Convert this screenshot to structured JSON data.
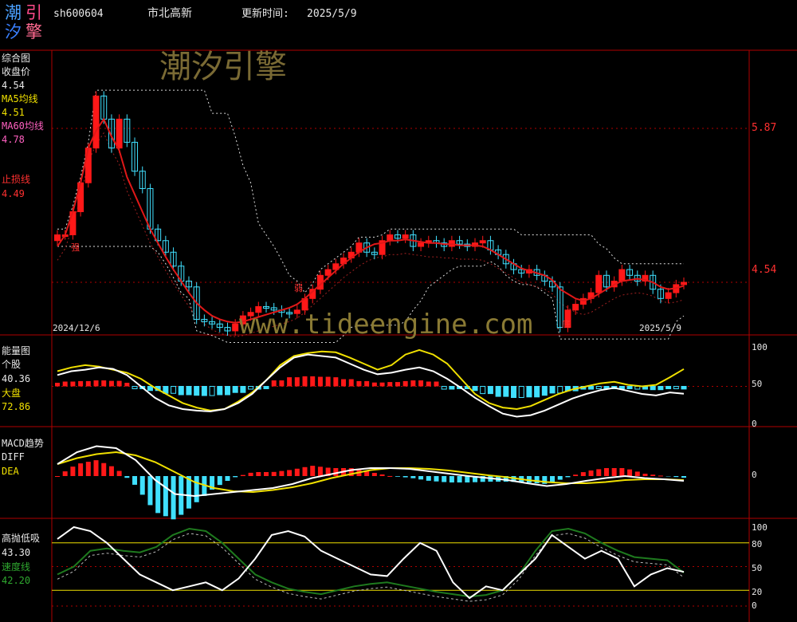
{
  "logo": {
    "c1": "潮",
    "c2": "引",
    "c3": "汐",
    "c4": "擎"
  },
  "header": {
    "code": "sh600604",
    "name": "市北高新",
    "update_label": "更新时间:",
    "update_date": "2025/5/9"
  },
  "watermark": {
    "cn": "潮汐引擎",
    "url": "www.tideengine.com"
  },
  "panel1": {
    "title": "综合图",
    "close_label": "收盘价",
    "close_value": "4.54",
    "ma5_label": "MA5均线",
    "ma5_value": "4.51",
    "ma60_label": "MA60均线",
    "ma60_value": "4.78",
    "stop_label": "止损线",
    "stop_value": "4.49",
    "right_ticks": [
      "5.87",
      "4.54"
    ],
    "date_start": "2024/12/6",
    "date_end": "2025/5/9",
    "marker_strong": "强",
    "marker_weak": "弱",
    "marker_bottom": "底"
  },
  "panel2": {
    "title": "能量图",
    "stock_label": "个股",
    "stock_value": "40.36",
    "market_label": "大盘",
    "market_value": "72.86",
    "ticks": [
      "100",
      "50",
      "0"
    ]
  },
  "panel3": {
    "title": "MACD趋势",
    "diff_label": "DIFF",
    "dea_label": "DEA",
    "ticks": [
      "0"
    ]
  },
  "panel4": {
    "title": "高抛低吸",
    "value1": "43.30",
    "speed_label": "速度线",
    "speed_value": "42.20",
    "ticks": [
      "100",
      "80",
      "50",
      "20",
      "0"
    ]
  },
  "colors": {
    "up": "#ff1818",
    "down": "#40e0ff",
    "ma": "#e01818",
    "grid": "#b00000",
    "yellow": "#f0e000",
    "green": "#1e7a1e"
  },
  "chart_data": [
    {
      "type": "candlestick",
      "title": "综合图",
      "x_start": "2024/12/6",
      "x_end": "2025/5/9",
      "ylim": [
        3.9,
        6.5
      ],
      "yticks": [
        5.87,
        4.54
      ],
      "close": [
        4.95,
        4.95,
        5.15,
        5.4,
        5.7,
        6.15,
        5.95,
        5.7,
        5.95,
        5.75,
        5.5,
        5.35,
        5.0,
        4.9,
        4.8,
        4.68,
        4.55,
        4.5,
        4.22,
        4.2,
        4.18,
        4.15,
        4.12,
        4.18,
        4.25,
        4.28,
        4.33,
        4.32,
        4.3,
        4.28,
        4.27,
        4.3,
        4.4,
        4.48,
        4.6,
        4.65,
        4.7,
        4.75,
        4.8,
        4.88,
        4.8,
        4.78,
        4.9,
        4.95,
        4.92,
        4.95,
        4.85,
        4.88,
        4.9,
        4.88,
        4.85,
        4.9,
        4.87,
        4.85,
        4.88,
        4.9,
        4.82,
        4.78,
        4.7,
        4.65,
        4.62,
        4.65,
        4.6,
        4.55,
        4.5,
        4.15,
        4.3,
        4.35,
        4.4,
        4.45,
        4.6,
        4.5,
        4.55,
        4.65,
        4.6,
        4.55,
        4.6,
        4.48,
        4.4,
        4.45,
        4.52,
        4.54
      ],
      "ma5": [
        4.85,
        4.95,
        5.15,
        5.4,
        5.7,
        5.85,
        5.95,
        5.8,
        5.68,
        5.45,
        5.3,
        5.15,
        5.0,
        4.88,
        4.76,
        4.65,
        4.55,
        4.45,
        4.36,
        4.3,
        4.25,
        4.22,
        4.2,
        4.19,
        4.2,
        4.22,
        4.24,
        4.26,
        4.28,
        4.3,
        4.32,
        4.35,
        4.4,
        4.46,
        4.52,
        4.58,
        4.64,
        4.7,
        4.75,
        4.8,
        4.84,
        4.87,
        4.88,
        4.9,
        4.9,
        4.91,
        4.9,
        4.89,
        4.88,
        4.88,
        4.87,
        4.87,
        4.86,
        4.86,
        4.86,
        4.85,
        4.82,
        4.78,
        4.74,
        4.7,
        4.66,
        4.64,
        4.62,
        4.6,
        4.56,
        4.48,
        4.44,
        4.4,
        4.38,
        4.4,
        4.44,
        4.48,
        4.52,
        4.55,
        4.56,
        4.57,
        4.56,
        4.54,
        4.5,
        4.48,
        4.49,
        4.51
      ],
      "ma60": 4.78,
      "stop_line": 4.49
    },
    {
      "type": "line",
      "title": "能量图",
      "ylim": [
        0,
        100
      ],
      "yticks": [
        100,
        50,
        0
      ],
      "series": [
        {
          "name": "个股",
          "values": [
            65,
            70,
            72,
            75,
            73,
            65,
            50,
            35,
            25,
            20,
            18,
            17,
            20,
            28,
            40,
            58,
            75,
            88,
            92,
            90,
            88,
            80,
            72,
            66,
            68,
            72,
            75,
            70,
            60,
            48,
            35,
            24,
            14,
            10,
            12,
            18,
            26,
            34,
            40,
            45,
            48,
            44,
            40,
            38,
            42,
            40.36
          ]
        },
        {
          "name": "大盘",
          "values": [
            70,
            75,
            78,
            76,
            72,
            68,
            60,
            48,
            38,
            28,
            22,
            18,
            20,
            30,
            42,
            58,
            78,
            90,
            94,
            96,
            95,
            88,
            80,
            72,
            78,
            92,
            98,
            92,
            80,
            60,
            40,
            28,
            22,
            20,
            24,
            32,
            40,
            46,
            50,
            54,
            56,
            52,
            50,
            52,
            62,
            72.86
          ]
        }
      ]
    },
    {
      "type": "line",
      "title": "MACD趋势",
      "ylim": [
        -1,
        1
      ],
      "yticks": [
        0
      ],
      "series": [
        {
          "name": "DIFF",
          "values": [
            0.3,
            0.6,
            0.75,
            0.7,
            0.4,
            -0.1,
            -0.45,
            -0.5,
            -0.45,
            -0.4,
            -0.35,
            -0.3,
            -0.2,
            -0.05,
            0.05,
            0.15,
            0.2,
            0.2,
            0.18,
            0.12,
            0.06,
            0.0,
            -0.05,
            -0.1,
            -0.18,
            -0.25,
            -0.2,
            -0.12,
            -0.05,
            0.0,
            -0.05,
            -0.08,
            -0.12
          ]
        },
        {
          "name": "DEA",
          "values": [
            0.3,
            0.45,
            0.55,
            0.6,
            0.52,
            0.35,
            0.1,
            -0.15,
            -0.3,
            -0.38,
            -0.4,
            -0.35,
            -0.28,
            -0.18,
            -0.05,
            0.05,
            0.15,
            0.2,
            0.2,
            0.18,
            0.14,
            0.08,
            0.02,
            -0.03,
            -0.1,
            -0.15,
            -0.18,
            -0.18,
            -0.15,
            -0.1,
            -0.08,
            -0.08,
            -0.1
          ]
        }
      ]
    },
    {
      "type": "line",
      "title": "高抛低吸",
      "ylim": [
        0,
        100
      ],
      "yticks": [
        100,
        80,
        50,
        20,
        0
      ],
      "series": [
        {
          "name": "高抛低吸",
          "values": [
            85,
            100,
            95,
            80,
            60,
            40,
            30,
            20,
            25,
            30,
            20,
            35,
            60,
            90,
            95,
            88,
            70,
            60,
            50,
            40,
            38,
            60,
            80,
            70,
            30,
            10,
            25,
            20,
            40,
            60,
            90,
            75,
            60,
            70,
            60,
            25,
            40,
            48,
            43.3
          ]
        },
        {
          "name": "速度线",
          "values": [
            40,
            50,
            70,
            73,
            70,
            68,
            75,
            90,
            98,
            95,
            80,
            60,
            40,
            30,
            22,
            18,
            15,
            20,
            25,
            28,
            30,
            26,
            22,
            18,
            15,
            12,
            14,
            20,
            40,
            70,
            95,
            98,
            92,
            80,
            70,
            62,
            60,
            58,
            42.2
          ]
        }
      ]
    }
  ]
}
